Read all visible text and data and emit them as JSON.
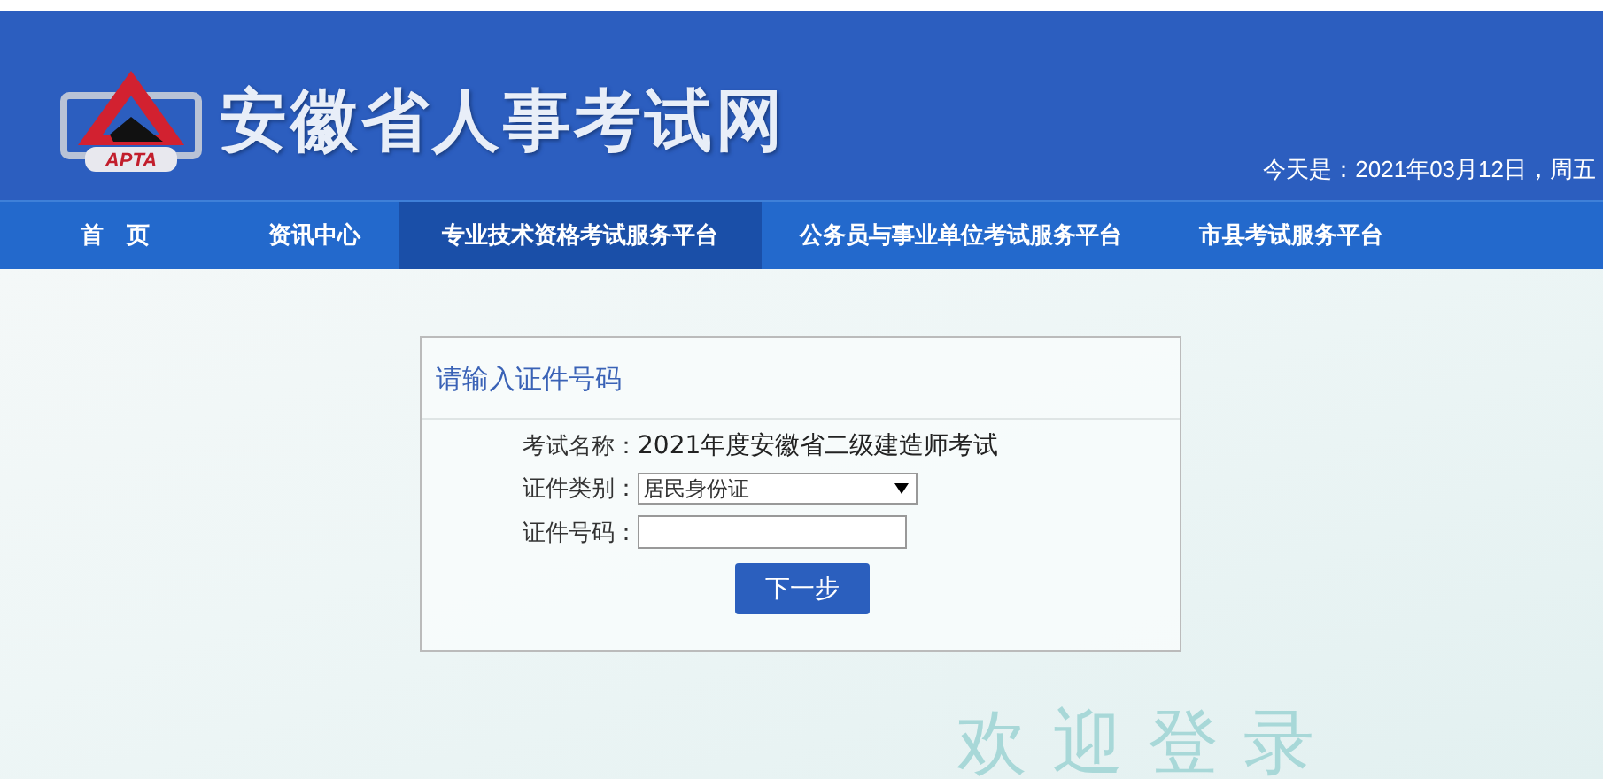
{
  "header": {
    "logo_text": "APTA",
    "site_title": "安徽省人事考试网",
    "date": "今天是：2021年03月12日，周五"
  },
  "nav": [
    {
      "label": "首　页",
      "selected": false
    },
    {
      "label": "资讯中心",
      "selected": false
    },
    {
      "label": "专业技术资格考试服务平台",
      "selected": true
    },
    {
      "label": "公务员与事业单位考试服务平台",
      "selected": false
    },
    {
      "label": "市县考试服务平台",
      "selected": false
    }
  ],
  "form": {
    "title": "请输入证件号码",
    "exam_label": "考试名称：",
    "exam_name": "2021年度安徽省二级建造师考试",
    "id_type_label": "证件类别：",
    "id_type_value": "居民身份证",
    "id_number_label": "证件号码：",
    "next_button": "下一步"
  },
  "welcome": "欢迎登录"
}
